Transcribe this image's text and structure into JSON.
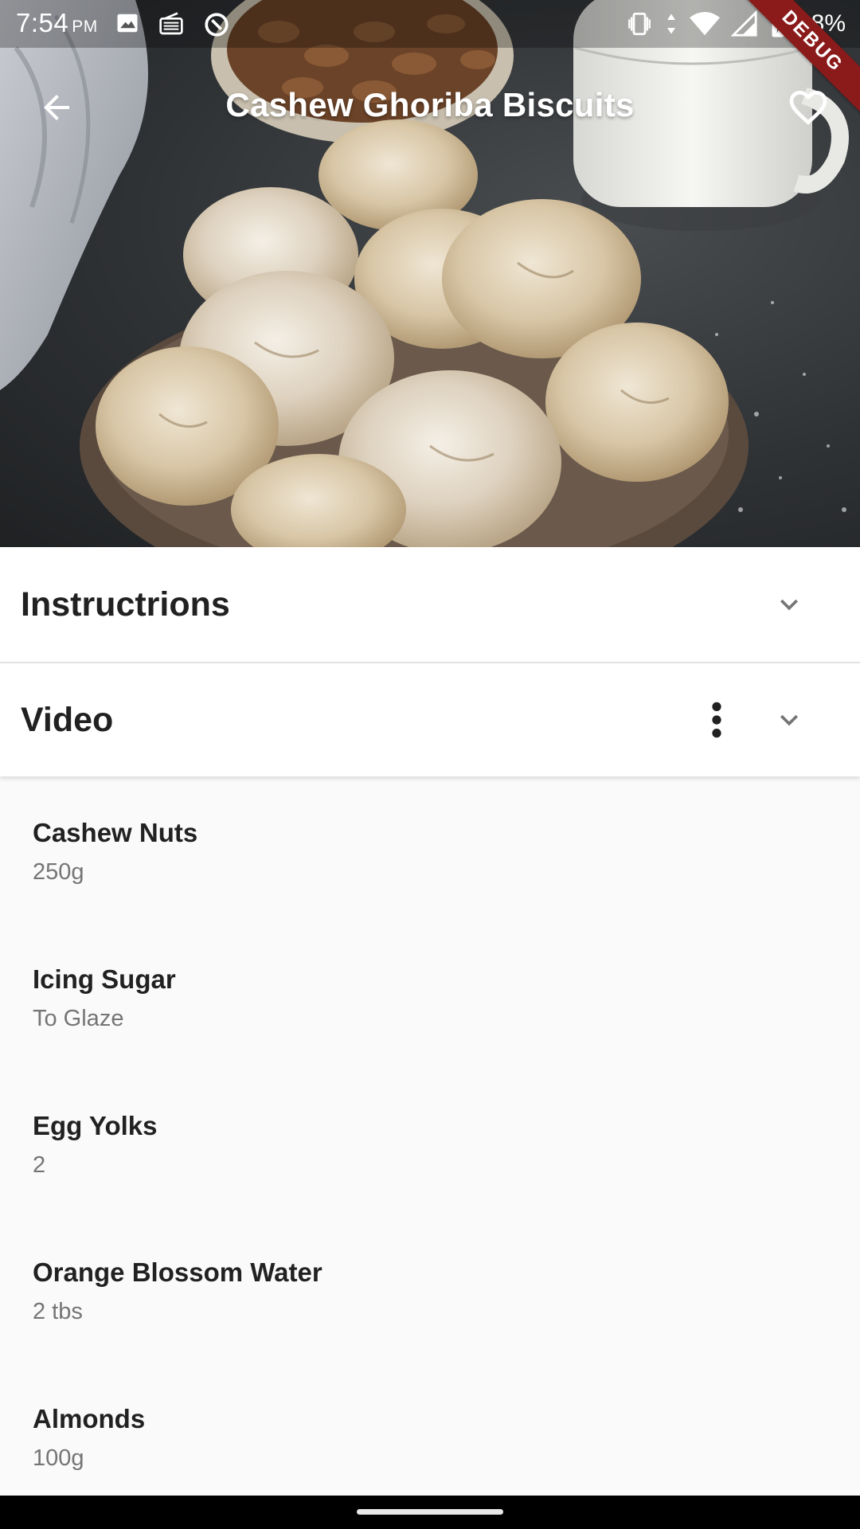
{
  "status_bar": {
    "time": "7:54",
    "ampm": "PM",
    "battery": "98%",
    "left_icons": [
      "image-icon",
      "radio-icon",
      "data-saver-icon"
    ],
    "right_icons": [
      "vibrate-icon",
      "data-arrows-icon",
      "wifi-icon",
      "signal-icon",
      "battery-charging-icon"
    ]
  },
  "debug_banner": "DEBUG",
  "app_bar": {
    "title": "Cashew Ghoriba Biscuits",
    "back_icon": "arrow-back-icon",
    "favorite_icon": "heart-outline-icon"
  },
  "hero": {
    "image": "cashew-ghoriba-biscuits-photo"
  },
  "panels": [
    {
      "title": "Instructrions",
      "expand_icon": "chevron-down-icon"
    },
    {
      "title": "Video",
      "more_icon": "more-vert-icon",
      "expand_icon": "chevron-down-icon"
    }
  ],
  "ingredients": [
    {
      "name": "Cashew Nuts",
      "measure": "250g"
    },
    {
      "name": "Icing Sugar",
      "measure": "To Glaze"
    },
    {
      "name": "Egg Yolks",
      "measure": "2"
    },
    {
      "name": "Orange Blossom Water",
      "measure": "2 tbs"
    },
    {
      "name": "Almonds",
      "measure": "100g"
    }
  ],
  "colors": {
    "accent_debug": "#8b1a1a",
    "title_text": "#212121",
    "secondary_text": "#757575",
    "background": "#fafafa"
  }
}
